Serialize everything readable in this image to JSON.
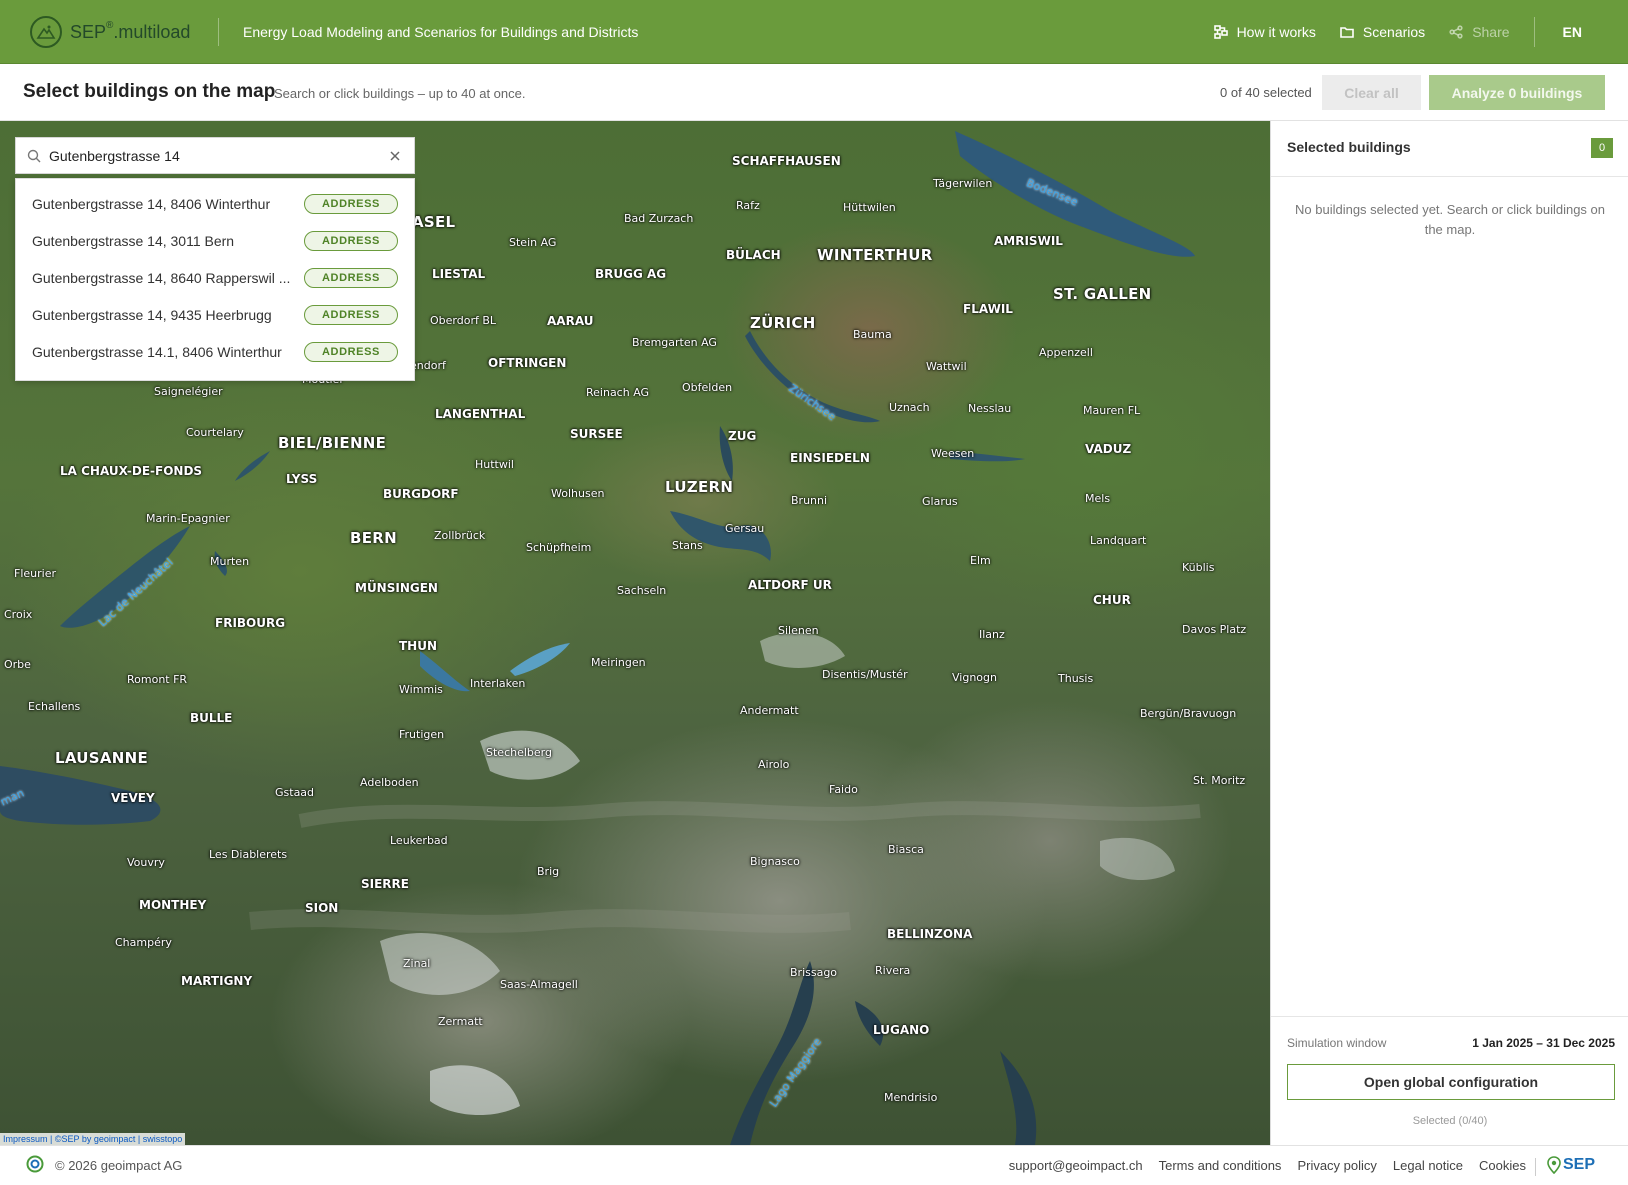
{
  "header": {
    "logo_sep": "SEP",
    "logo_reg": "®",
    "logo_suffix": ".multiload",
    "tagline": "Energy Load Modeling and Scenarios for Buildings and Districts",
    "nav": {
      "how_it_works": "How it works",
      "scenarios": "Scenarios",
      "share": "Share",
      "language": "EN"
    }
  },
  "toolbar": {
    "title": "Select buildings on the map",
    "hint": "Search or click buildings – up to 40 at once.",
    "selected_count": "0 of 40 selected",
    "clear_label": "Clear all",
    "analyze_label": "Analyze 0 buildings"
  },
  "search": {
    "value": "Gutenbergstrasse 14",
    "results": [
      {
        "label": "Gutenbergstrasse 14, 8406 Winterthur",
        "type": "ADDRESS"
      },
      {
        "label": "Gutenbergstrasse 14, 3011 Bern",
        "type": "ADDRESS"
      },
      {
        "label": "Gutenbergstrasse 14, 8640 Rapperswil ...",
        "type": "ADDRESS"
      },
      {
        "label": "Gutenbergstrasse 14, 9435 Heerbrugg",
        "type": "ADDRESS"
      },
      {
        "label": "Gutenbergstrasse 14.1, 8406 Winterthur",
        "type": "ADDRESS"
      }
    ]
  },
  "map": {
    "attribution": "Impressum | ©SEP by geoimpact | swisstopo",
    "places": {
      "schaffhausen": "SCHAFFHAUSEN",
      "taegerwilen": "Tägerwilen",
      "rafz": "Rafz",
      "huettwilen": "Hüttwilen",
      "basel": "ASEL",
      "bad_zurzach": "Bad Zurzach",
      "stein_ag": "Stein AG",
      "buelach": "BÜLACH",
      "winterthur": "WINTERTHUR",
      "amriswil": "AMRISWIL",
      "liestal": "LIESTAL",
      "brugg": "BRUGG AG",
      "st_gallen": "ST. GALLEN",
      "flawil": "FLAWIL",
      "oberdorf": "Oberdorf BL",
      "aarau": "AARAU",
      "zuerich": "ZÜRICH",
      "bremgarten": "Bremgarten AG",
      "bauma": "Bauma",
      "appenzell": "Appenzell",
      "endorf": "endorf",
      "oftringen": "OFTRINGEN",
      "wattwil": "Wattwil",
      "moutier": "Moutier",
      "reinach": "Reinach AG",
      "obfelden": "Obfelden",
      "saignelegier": "Saignelégier",
      "uznach": "Uznach",
      "nesslau": "Nesslau",
      "mauren": "Mauren FL",
      "langenthal": "LANGENTHAL",
      "courtelary": "Courtelary",
      "sursee": "SURSEE",
      "zug": "ZUG",
      "biel": "BIEL/BIENNE",
      "weesen": "Weesen",
      "vaduz": "VADUZ",
      "einsiedeln": "EINSIEDELN",
      "chaux": "LA CHAUX-DE-FONDS",
      "huttwil": "Huttwil",
      "luzern": "LUZERN",
      "lyss": "LYSS",
      "burgdorf": "BURGDORF",
      "wolhusen": "Wolhusen",
      "brunni": "Brunni",
      "glarus": "Glarus",
      "mels": "Mels",
      "marin": "Marin-Epagnier",
      "gersau": "Gersau",
      "bern": "BERN",
      "zollbrueck": "Zollbrück",
      "landquart": "Landquart",
      "schuepfheim": "Schüpfheim",
      "stans": "Stans",
      "murten": "Murten",
      "elm": "Elm",
      "kueblis": "Küblis",
      "fleurier": "Fleurier",
      "sachseln": "Sachseln",
      "muensingen": "MÜNSINGEN",
      "altdorf": "ALTDORF UR",
      "chur": "CHUR",
      "croix": "Croix",
      "fribourg": "FRIBOURG",
      "silenen": "Silenen",
      "davos": "Davos Platz",
      "ilanz": "Ilanz",
      "thun": "THUN",
      "orbe": "Orbe",
      "meiringen": "Meiringen",
      "disentis": "Disentis/Mustér",
      "vignogn": "Vignogn",
      "romont": "Romont FR",
      "thusis": "Thusis",
      "wimmis": "Wimmis",
      "interlaken": "Interlaken",
      "echallens": "Echallens",
      "andermatt": "Andermatt",
      "bulle": "BULLE",
      "berguen": "Bergün/Bravuogn",
      "frutigen": "Frutigen",
      "lausanne": "LAUSANNE",
      "stechelberg": "Stechelberg",
      "airolo": "Airolo",
      "st_moritz": "St. Moritz",
      "adelboden": "Adelboden",
      "gstaad": "Gstaad",
      "vevey": "VEVEY",
      "faido": "Faido",
      "leukerbad": "Leukerbad",
      "les_diablerets": "Les Diablerets",
      "biasca": "Biasca",
      "bignasco": "Bignasco",
      "vouvry": "Vouvry",
      "brig": "Brig",
      "sierre": "SIERRE",
      "monthey": "MONTHEY",
      "sion": "SION",
      "champery": "Champéry",
      "bellinzona": "BELLINZONA",
      "zinal": "Zinal",
      "martigny": "MARTIGNY",
      "saas": "Saas-Almagell",
      "brissago": "Brissago",
      "rivera": "Rivera",
      "zermatt": "Zermatt",
      "lugano": "LUGANO",
      "mendrisio": "Mendrisio"
    },
    "lakes": {
      "bodensee": "Bodensee",
      "zuerichsee": "Zürichsee",
      "neuchatel": "Lac de Neuchâtel",
      "leman": "man",
      "maggiore": "Lago Maggiore"
    },
    "colors": {
      "lake": "#2f5a7a",
      "glacier": "#dfe4e6"
    }
  },
  "panel": {
    "title": "Selected buildings",
    "count": "0",
    "empty_message": "No buildings selected yet. Search or click buildings on the map.",
    "sim_label": "Simulation window",
    "sim_value": "1 Jan 2025 – 31 Dec 2025",
    "config_label": "Open global configuration",
    "selected_note": "Selected (0/40)"
  },
  "footer": {
    "copyright": "© 2026 geoimpact AG",
    "links": [
      "support@geoimpact.ch",
      "Terms and conditions",
      "Privacy policy",
      "Legal notice",
      "Cookies"
    ],
    "brand": "SEP"
  },
  "theme": {
    "primary": "#6a9b3c",
    "primary_dark": "#23492a",
    "link_blue": "#1d6fb6"
  }
}
